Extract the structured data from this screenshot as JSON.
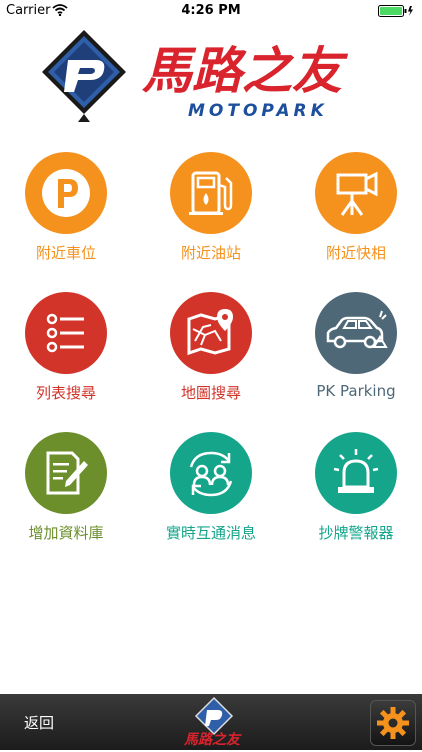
{
  "status_bar": {
    "carrier": "Carrier",
    "time": "4:26 PM"
  },
  "logo": {
    "chinese_text": "馬路之友",
    "english_text": "MOTOPARK"
  },
  "menu": [
    {
      "label": "附近車位",
      "color": "#F5921E",
      "icon": "parking-icon"
    },
    {
      "label": "附近油站",
      "color": "#F5921E",
      "icon": "gas-station-icon"
    },
    {
      "label": "附近快相",
      "color": "#F5921E",
      "icon": "speed-camera-icon"
    },
    {
      "label": "列表搜尋",
      "color": "#D2342A",
      "icon": "list-icon"
    },
    {
      "label": "地圖搜尋",
      "color": "#D2342A",
      "icon": "map-icon"
    },
    {
      "label": "PK Parking",
      "color": "#4E6878",
      "icon": "car-icon"
    },
    {
      "label": "增加資料庫",
      "color": "#6C8F2C",
      "icon": "edit-document-icon"
    },
    {
      "label": "實時互通消息",
      "color": "#15A58B",
      "icon": "users-exchange-icon"
    },
    {
      "label": "抄牌警報器",
      "color": "#15A58B",
      "icon": "siren-icon"
    }
  ],
  "bottom_bar": {
    "back_label": "返回"
  }
}
